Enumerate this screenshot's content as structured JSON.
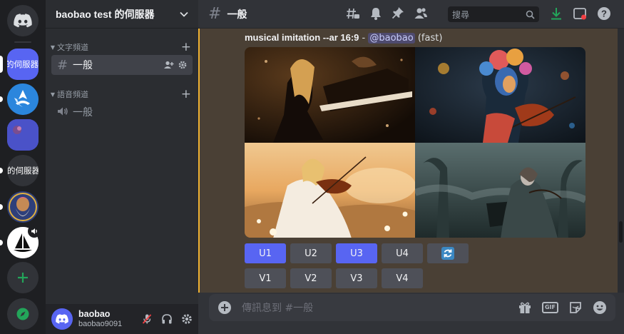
{
  "colors": {
    "accent": "#5865f2",
    "success": "#23a55a",
    "mention": "#f0b232"
  },
  "servers": [
    {
      "label": "t的伺服器",
      "kind": "text",
      "selected": true
    },
    {
      "label": "",
      "kind": "image"
    },
    {
      "label": "",
      "kind": "image"
    },
    {
      "label": "的伺服器",
      "kind": "text"
    },
    {
      "label": "",
      "kind": "image"
    },
    {
      "label": "",
      "kind": "image"
    }
  ],
  "guild": {
    "name": "baobao test 的伺服器"
  },
  "categories": {
    "text": "文字頻道",
    "voice": "語音頻道"
  },
  "channels": {
    "text_channel": "一般",
    "voice_channel": "一般"
  },
  "user": {
    "name": "baobao",
    "tag": "baobao9091"
  },
  "topbar": {
    "channel": "一般",
    "search_placeholder": "搜尋"
  },
  "message": {
    "prompt": "musical imitation --ar 16:9",
    "separator": " - ",
    "mention": "@baobao",
    "mode": "(fast)"
  },
  "buttons": {
    "upscale": [
      "U1",
      "U2",
      "U3",
      "U4"
    ],
    "variation": [
      "V1",
      "V2",
      "V3",
      "V4"
    ]
  },
  "composer": {
    "placeholder": "傳訊息到 #一般"
  }
}
